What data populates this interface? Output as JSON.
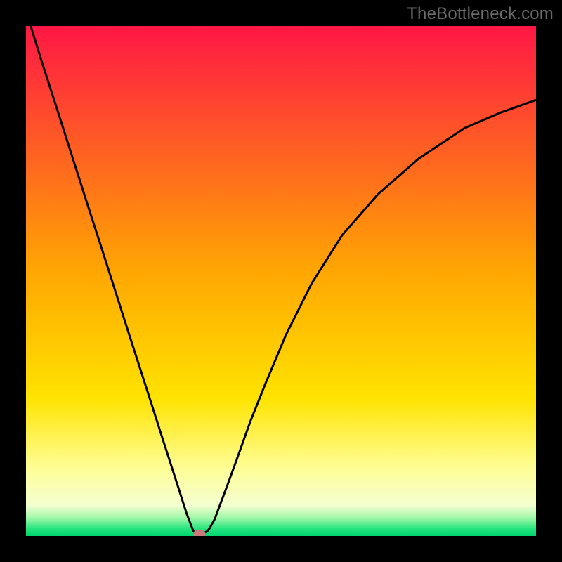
{
  "watermark": "TheBottleneck.com",
  "chart_data": {
    "type": "line",
    "title": "",
    "xlabel": "",
    "ylabel": "",
    "xlim": [
      0,
      1
    ],
    "ylim": [
      0,
      1
    ],
    "legend": false,
    "grid": false,
    "background_gradient": {
      "direction": "vertical",
      "stops": [
        {
          "offset": 0.0,
          "color": "#ff1745"
        },
        {
          "offset": 0.48,
          "color": "#ffa602"
        },
        {
          "offset": 0.73,
          "color": "#ffe300"
        },
        {
          "offset": 0.86,
          "color": "#fffd8f"
        },
        {
          "offset": 0.94,
          "color": "#f4ffd0"
        },
        {
          "offset": 0.965,
          "color": "#9ef7a8"
        },
        {
          "offset": 0.985,
          "color": "#28e57e"
        },
        {
          "offset": 1.0,
          "color": "#00d56f"
        }
      ]
    },
    "series": [
      {
        "name": "bottleneck-curve",
        "color": "#000000",
        "x": [
          0.0,
          0.03,
          0.06,
          0.09,
          0.12,
          0.15,
          0.18,
          0.21,
          0.24,
          0.27,
          0.3,
          0.315,
          0.328,
          0.336,
          0.34,
          0.348,
          0.356,
          0.36,
          0.37,
          0.38,
          0.395,
          0.415,
          0.44,
          0.47,
          0.51,
          0.56,
          0.62,
          0.69,
          0.77,
          0.86,
          0.93,
          1.0
        ],
        "y": [
          1.03,
          0.933,
          0.84,
          0.746,
          0.652,
          0.559,
          0.465,
          0.371,
          0.278,
          0.184,
          0.091,
          0.044,
          0.01,
          0.0,
          0.0,
          0.005,
          0.01,
          0.015,
          0.033,
          0.06,
          0.1,
          0.155,
          0.225,
          0.3,
          0.395,
          0.495,
          0.59,
          0.67,
          0.74,
          0.8,
          0.83,
          0.855
        ]
      }
    ],
    "marker": {
      "name": "optimal-point",
      "x": 0.34,
      "y": 0.004,
      "rx": 0.012,
      "ry": 0.009,
      "fill": "#c97a7a"
    }
  }
}
